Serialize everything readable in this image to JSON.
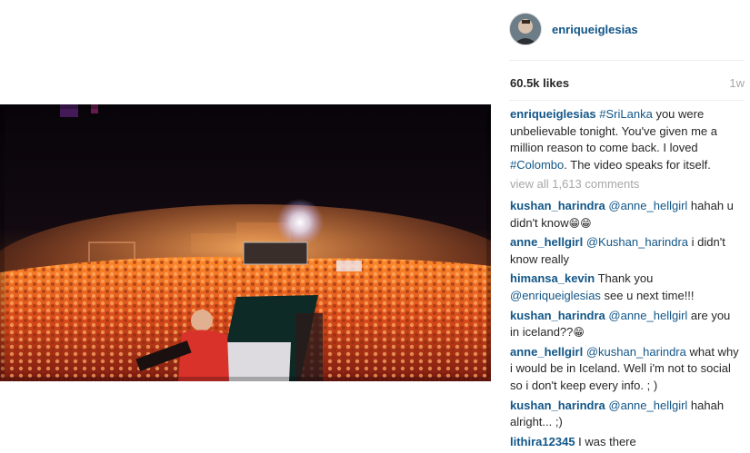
{
  "post": {
    "username": "enriqueiglesias",
    "likes": "60.5k likes",
    "time_ago": "1w",
    "caption": {
      "user": "enriqueiglesias",
      "parts": [
        {
          "type": "tag",
          "text": "#SriLanka"
        },
        {
          "type": "text",
          "text": " you were unbelievable tonight. You've given me a million reason to come back. I loved "
        },
        {
          "type": "tag",
          "text": "#Colombo"
        },
        {
          "type": "text",
          "text": ". The video speaks for itself."
        }
      ]
    },
    "view_all_comments": "view all 1,613 comments",
    "comments": [
      {
        "user": "kushan_harindra",
        "mention": "@anne_hellgirl",
        "text": " hahah u didn't know",
        "emoji": "😁😁"
      },
      {
        "user": "anne_hellgirl",
        "mention": "@Kushan_harindra",
        "text": " i didn't know really",
        "emoji": ""
      },
      {
        "user": "himansa_kevin",
        "mention": "",
        "text": " Thank you ",
        "mention2": "@enriqueiglesias",
        "text2": " see u next time!!!",
        "emoji": ""
      },
      {
        "user": "kushan_harindra",
        "mention": "@anne_hellgirl",
        "text": " are you in iceland??",
        "emoji": "😁"
      },
      {
        "user": "anne_hellgirl",
        "mention": "@kushan_harindra",
        "text": " what why i would be in Iceland. Well i'm not to social so i don't keep every info. ; )",
        "emoji": ""
      },
      {
        "user": "kushan_harindra",
        "mention": "@anne_hellgirl",
        "text": " hahah alright... ;)",
        "emoji": ""
      },
      {
        "user": "lithira12345",
        "mention": "",
        "text": " I was there",
        "emoji": ""
      }
    ]
  },
  "colors": {
    "username_blue": "#125688",
    "text": "#262626",
    "muted": "#a5a7aa",
    "divider": "#efefef"
  },
  "icons": {
    "avatar": "profile-photo",
    "video": "concert-video-still"
  }
}
